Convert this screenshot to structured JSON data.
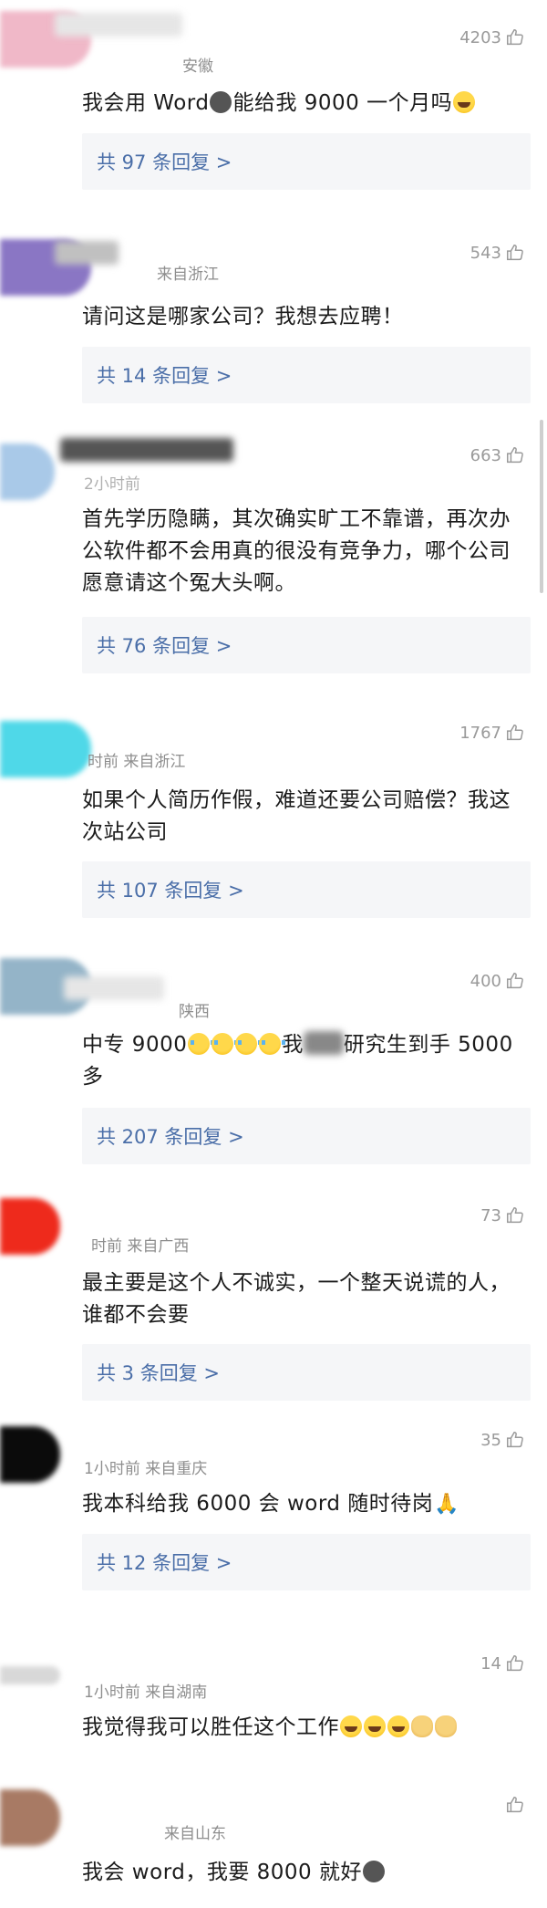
{
  "comments": [
    {
      "meta": "安徽",
      "likes": "4203",
      "text": "我会用 Word",
      "text2": "能给我 9000 一个月吗",
      "replies": "共 97 条回复 >"
    },
    {
      "meta": "来自浙江",
      "likes": "543",
      "text": "请问这是哪家公司？我想去应聘！",
      "replies": "共 14 条回复 >"
    },
    {
      "meta": "2小时前",
      "likes": "663",
      "text": "首先学历隐瞒，其次确实旷工不靠谱，再次办公软件都不会用真的很没有竞争力，哪个公司愿意请这个冤大头啊。",
      "replies": "共 76 条回复 >"
    },
    {
      "meta": "时前   来自浙江",
      "likes": "1767",
      "text": "如果个人简历作假，难道还要公司赔偿？我这次站公司",
      "replies": "共 107 条回复 >"
    },
    {
      "meta": "陕西",
      "likes": "400",
      "text": "中专 9000",
      "text2": "我",
      "text3": "研究生到手 5000 多",
      "replies": "共 207 条回复 >"
    },
    {
      "meta": "时前   来自广西",
      "likes": "73",
      "text": "最主要是这个人不诚实，一个整天说谎的人，谁都不会要",
      "replies": "共 3 条回复 >"
    },
    {
      "meta": "1小时前   来自重庆",
      "likes": "35",
      "text": "我本科给我 6000 会 word 随时待岗",
      "replies": "共 12 条回复 >"
    },
    {
      "meta": "1小时前   来自湖南",
      "likes": "14",
      "text": "我觉得我可以胜任这个工作"
    },
    {
      "meta": "来自山东",
      "likes": "",
      "text": "我会 word，我要 8000 就好"
    }
  ],
  "icons": {
    "like": "thumbs-up-icon"
  },
  "colors": {
    "reply_link": "#4a6ea8",
    "reply_bg": "#f5f6f8",
    "meta": "#8e8e8e"
  }
}
